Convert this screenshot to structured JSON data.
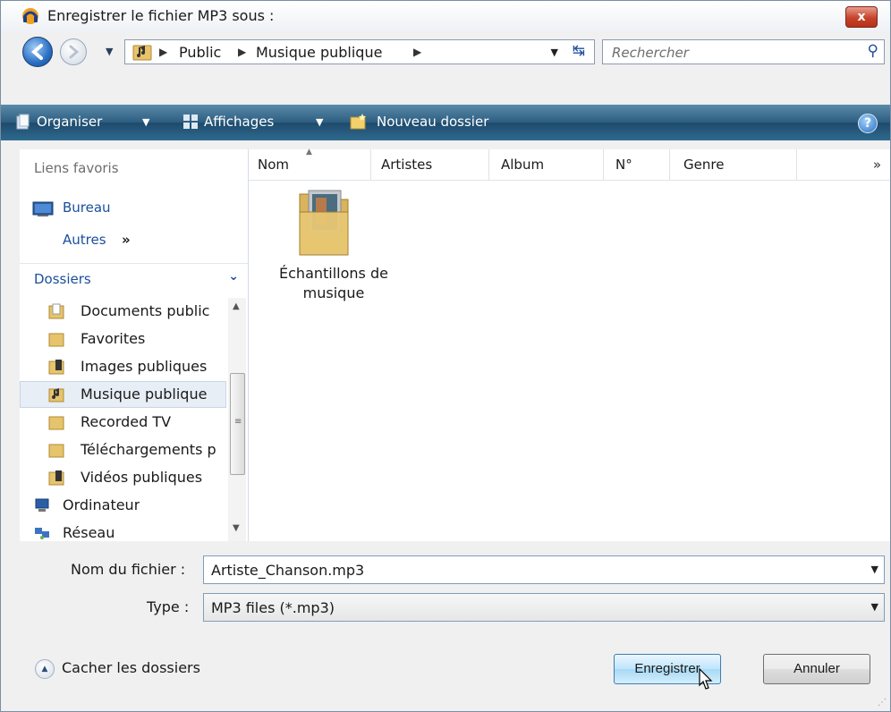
{
  "window": {
    "title": "Enregistrer le fichier MP3 sous :",
    "close_label": "x"
  },
  "address": {
    "crumbs": [
      "Public",
      "Musique publique"
    ],
    "search_placeholder": "Rechercher"
  },
  "toolbar": {
    "organize": "Organiser",
    "views": "Affichages",
    "new_folder": "Nouveau dossier",
    "help": "?"
  },
  "sidebar": {
    "favorites_title": "Liens favoris",
    "favorites": [
      {
        "label": "Bureau",
        "icon": "desktop-icon"
      },
      {
        "label": "Autres",
        "more": "»"
      }
    ],
    "folders_label": "Dossiers",
    "tree": [
      {
        "label": "Documents public",
        "icon": "folder-documents-icon"
      },
      {
        "label": "Favorites",
        "icon": "folder-icon"
      },
      {
        "label": "Images publiques",
        "icon": "folder-images-icon"
      },
      {
        "label": "Musique publique",
        "icon": "folder-music-icon",
        "selected": true
      },
      {
        "label": "Recorded TV",
        "icon": "folder-icon"
      },
      {
        "label": "Téléchargements p",
        "icon": "folder-icon"
      },
      {
        "label": "Vidéos publiques",
        "icon": "folder-videos-icon"
      },
      {
        "label": "Ordinateur",
        "icon": "computer-icon"
      },
      {
        "label": "Réseau",
        "icon": "network-icon"
      }
    ]
  },
  "list": {
    "columns": [
      "Nom",
      "Artistes",
      "Album",
      "N°",
      "Genre"
    ],
    "more": "»",
    "items": [
      {
        "label_line1": "Échantillons de",
        "label_line2": "musique",
        "icon": "music-folder-icon"
      }
    ]
  },
  "form": {
    "filename_label": "Nom du fichier :",
    "filename_value": "Artiste_Chanson.mp3",
    "type_label": "Type :",
    "type_value": "MP3 files (*.mp3)"
  },
  "footer": {
    "hide_folders": "Cacher les dossiers",
    "save": "Enregistrer",
    "cancel": "Annuler"
  },
  "colors": {
    "command_bar": "#2c5d80",
    "link": "#1a4f9c",
    "close": "#c5432b"
  }
}
